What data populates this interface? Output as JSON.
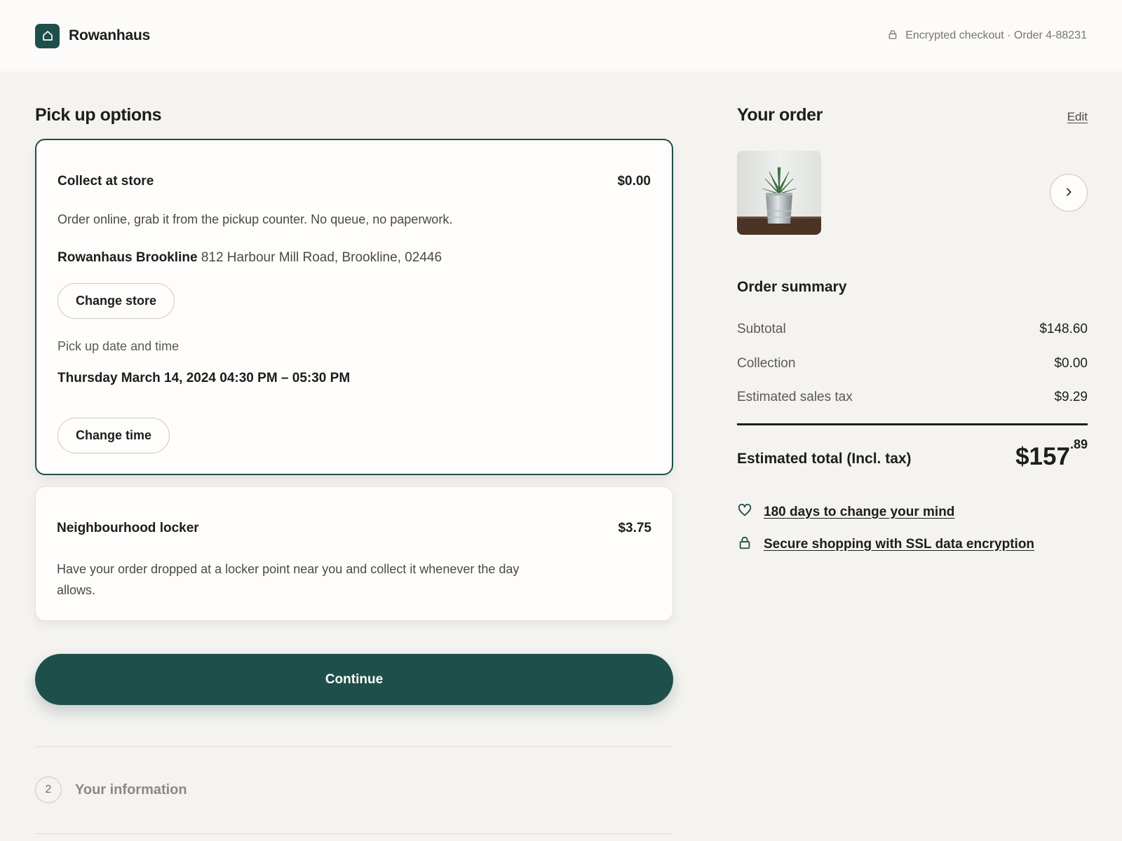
{
  "header": {
    "brand": "Rowanhaus",
    "secure_note": "Encrypted checkout · Order 4-88231",
    "logo_icon": "home-icon"
  },
  "pickup": {
    "title": "Pick up options",
    "selected_option": {
      "title": "Collect at store",
      "price": "$0.00",
      "description": "Order online, grab it from the pickup counter. No queue, no paperwork.",
      "store_name": "Rowanhaus Brookline",
      "store_address": "812 Harbour Mill Road, Brookline, 02446",
      "change_store_label": "Change store",
      "date_label": "Pick up date and time",
      "datetime": "Thursday March 14, 2024 04:30 PM – 05:30 PM",
      "change_time_label": "Change time"
    },
    "other_option": {
      "title": "Neighbourhood locker",
      "price": "$3.75",
      "description": "Have your order dropped at a locker point near you and collect it whenever the day allows."
    },
    "continue_label": "Continue",
    "next_step": {
      "number": "2",
      "label": "Your information"
    }
  },
  "order": {
    "title": "Your order",
    "edit_label": "Edit",
    "summary_title": "Order summary",
    "rows": [
      {
        "label": "Subtotal",
        "value": "$148.60"
      },
      {
        "label": "Collection",
        "value": "$0.00"
      },
      {
        "label": "Estimated sales tax",
        "value": "$9.29"
      }
    ],
    "total_label": "Estimated total (Incl. tax)",
    "total_main": "$157",
    "total_cents": ".89",
    "perks": [
      {
        "icon": "heart-icon",
        "label": "180 days to change your mind"
      },
      {
        "icon": "lock-icon",
        "label": "Secure shopping with SSL data encryption"
      }
    ]
  },
  "colors": {
    "accent": "#1f4f4a",
    "background": "#f4f3f0",
    "card": "#fefdfb"
  }
}
